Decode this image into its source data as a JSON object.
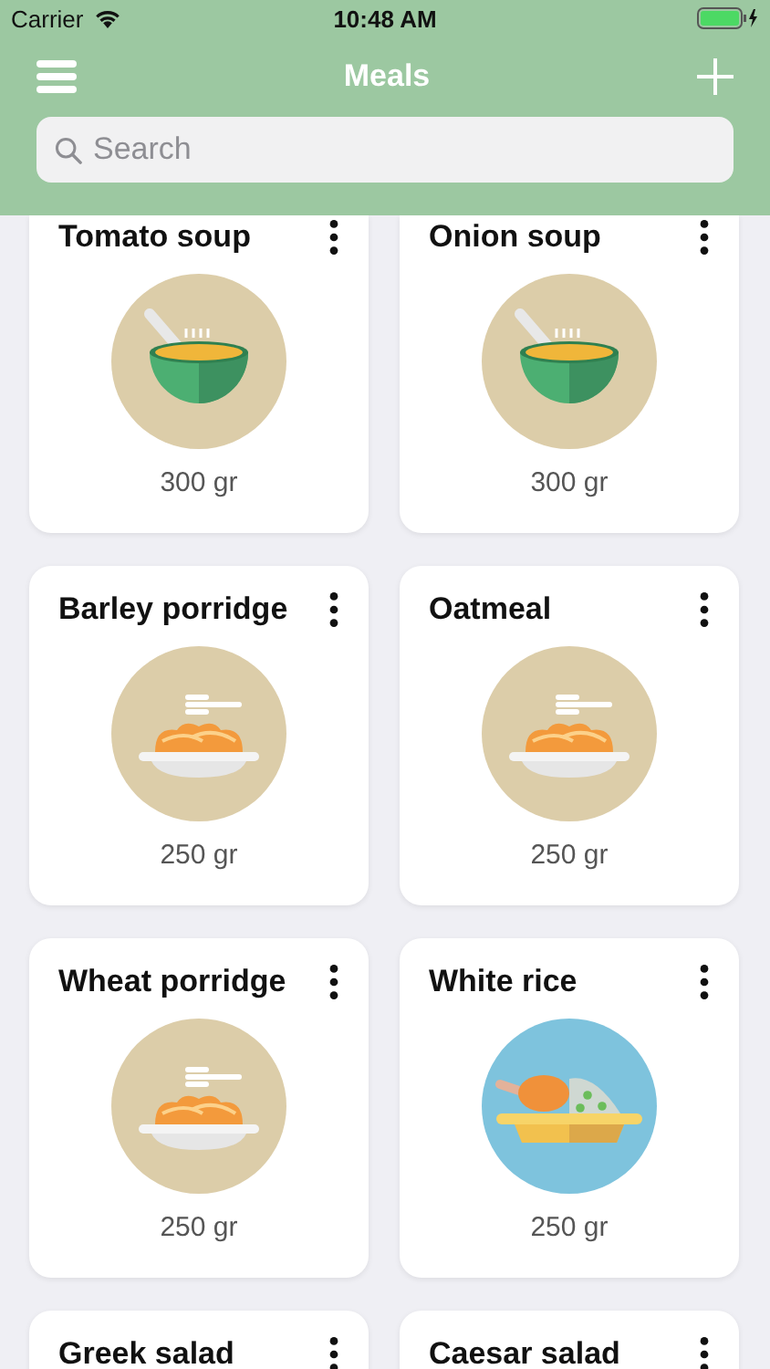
{
  "status_bar": {
    "carrier": "Carrier",
    "time": "10:48 AM"
  },
  "nav": {
    "title": "Meals"
  },
  "search": {
    "placeholder": "Search"
  },
  "meals": [
    {
      "name": "Tomato soup",
      "kind": "soup",
      "weight": "300 gr"
    },
    {
      "name": "Onion soup",
      "kind": "soup",
      "weight": "300 gr"
    },
    {
      "name": "Barley porridge",
      "kind": "pasta",
      "weight": "250 gr"
    },
    {
      "name": "Oatmeal",
      "kind": "pasta",
      "weight": "250 gr"
    },
    {
      "name": "Wheat porridge",
      "kind": "pasta",
      "weight": "250 gr"
    },
    {
      "name": "White rice",
      "kind": "chicken",
      "weight": "250 gr"
    },
    {
      "name": "Greek salad"
    },
    {
      "name": "Caesar salad"
    }
  ]
}
